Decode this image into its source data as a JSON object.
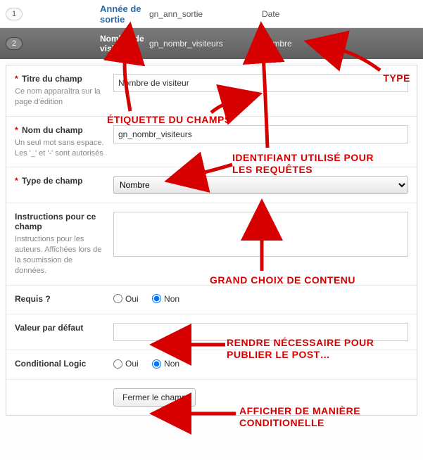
{
  "row1": {
    "order": "1",
    "title": "Année de sortie",
    "name": "gn_ann_sortie",
    "type": "Date"
  },
  "row2": {
    "order": "2",
    "title": "Nombre de visiteur",
    "name": "gn_nombr_visiteurs",
    "type": "Nombre"
  },
  "form": {
    "title": {
      "label": "Titre du champ",
      "hint": "Ce nom apparaîtra sur la page d'édition",
      "value": "Nombre de visiteur"
    },
    "name": {
      "label": "Nom du champ",
      "hint": "Un seul mot sans espace.\nLes '_' et '-' sont autorisés",
      "value": "gn_nombr_visiteurs"
    },
    "type": {
      "label": "Type de champ",
      "value": "Nombre"
    },
    "instructions": {
      "label": "Instructions pour ce champ",
      "hint": "Instructions pour les auteurs. Affichées lors de la soumission de données.",
      "value": ""
    },
    "required": {
      "label": "Requis ?",
      "yes": "Oui",
      "no": "Non",
      "value": "Non"
    },
    "default": {
      "label": "Valeur par défaut",
      "value": ""
    },
    "conditional": {
      "label": "Conditional Logic",
      "yes": "Oui",
      "no": "Non",
      "value": "Non"
    },
    "close_label": "Fermer le champ"
  },
  "annotations": {
    "type": "TYPE",
    "etiquette": "ÉTIQUETTE DU CHAMPS",
    "identifiant": "IDENTIFIANT UTILISÉ POUR LES REQUÊTES",
    "grand_choix": "GRAND CHOIX DE CONTENU",
    "rendre_necessaire": "RENDRE NÉCESSAIRE POUR PUBLIER LE POST…",
    "afficher_cond": "AFFICHER DE MANIÈRE CONDITIONELLE"
  },
  "colors": {
    "annotation": "#d60000",
    "header_bg": "#6a6a6a",
    "link": "#2e6aa8"
  }
}
